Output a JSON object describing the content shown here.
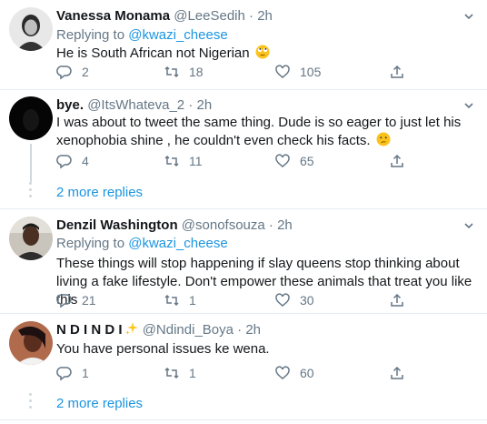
{
  "tweets": [
    {
      "name": "Vanessa Monama",
      "handle": "@LeeSedih",
      "time": "· 2h",
      "replying_prefix": "Replying to ",
      "replying_handle": "@kwazi_cheese",
      "text": "He is South African not Nigerian",
      "emoji": "rolling-eyes-emoji",
      "replies": "2",
      "retweets": "18",
      "likes": "105"
    },
    {
      "name": "bye.",
      "handle": "@ItsWhateva_2",
      "time": "· 2h",
      "text": "I was about to tweet the same thing. Dude is so eager to just let his xenophobia shine , he couldn't even check his facts.",
      "emoji": "confused-face-emoji",
      "replies": "4",
      "retweets": "11",
      "likes": "65"
    },
    {
      "name": "Denzil Washington",
      "handle": "@sonofsouza",
      "time": "· 2h",
      "replying_prefix": "Replying to ",
      "replying_handle": "@kwazi_cheese",
      "text": "These things will stop happening if slay queens stop thinking about living a fake lifestyle. Don't empower these animals that treat you like this",
      "replies": "21",
      "retweets": "1",
      "likes": "30"
    },
    {
      "name": "N D I N D I",
      "name_emoji": "sparkles-emoji",
      "handle": "@Ndindi_Boya",
      "time": "· 2h",
      "text": "You have personal issues ke wena.",
      "replies": "1",
      "retweets": "1",
      "likes": "60"
    }
  ],
  "more_replies_1": "2 more replies",
  "more_replies_2": "2 more replies",
  "colors": {
    "link": "#1b95e0",
    "muted": "#657786",
    "divider": "#e6ecf0",
    "thread": "#cfd9de"
  }
}
